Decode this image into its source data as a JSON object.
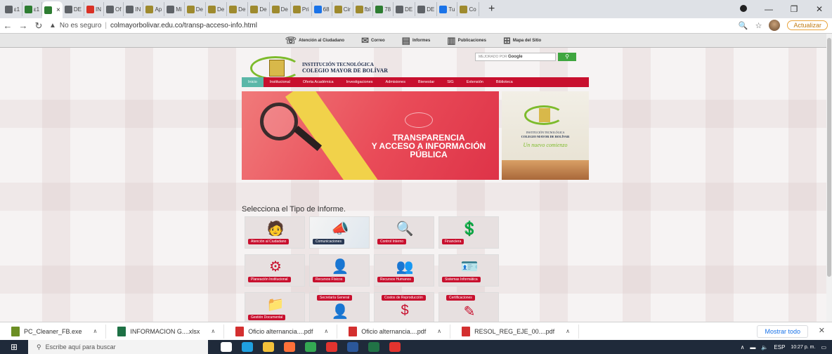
{
  "browser": {
    "tabs": [
      {
        "label": "ε1",
        "fav_color": "#5f6368"
      },
      {
        "label": "ε1",
        "fav_color": "#2e7d32"
      },
      {
        "label": "",
        "fav_color": "#2e7d32",
        "active": true
      },
      {
        "label": "DE",
        "fav_color": "#5f6368"
      },
      {
        "label": "IN",
        "fav_color": "#d93025"
      },
      {
        "label": "Of",
        "fav_color": "#5f6368"
      },
      {
        "label": "IN",
        "fav_color": "#5f6368"
      },
      {
        "label": "Ap",
        "fav_color": "#9e8a2e"
      },
      {
        "label": "Mi",
        "fav_color": "#5f6368"
      },
      {
        "label": "De",
        "fav_color": "#9e8a2e"
      },
      {
        "label": "De",
        "fav_color": "#9e8a2e"
      },
      {
        "label": "De",
        "fav_color": "#9e8a2e"
      },
      {
        "label": "De",
        "fav_color": "#9e8a2e"
      },
      {
        "label": "De",
        "fav_color": "#9e8a2e"
      },
      {
        "label": "Pri",
        "fav_color": "#9e8a2e"
      },
      {
        "label": "68",
        "fav_color": "#1a73e8"
      },
      {
        "label": "Cir",
        "fav_color": "#9e8a2e"
      },
      {
        "label": "fbl",
        "fav_color": "#9e8a2e"
      },
      {
        "label": "78",
        "fav_color": "#2e7d32"
      },
      {
        "label": "DE",
        "fav_color": "#5f6368"
      },
      {
        "label": "DE",
        "fav_color": "#5f6368"
      },
      {
        "label": "Tu",
        "fav_color": "#1a73e8"
      },
      {
        "label": "Co",
        "fav_color": "#9e8a2e"
      }
    ],
    "tab_close_glyph": "×",
    "new_tab_glyph": "+",
    "address": {
      "security_text": "No es seguro",
      "url": "colmayorbolivar.edu.co/transp-acceso-info.html"
    },
    "update_label": "Actualizar"
  },
  "site": {
    "topnav": [
      "Atención al Ciudadano",
      "Correo",
      "Informes",
      "Publicaciones",
      "Mapa del Sitio"
    ],
    "institution_line1": "INSTITUCIÓN TECNOLÓGICA",
    "institution_line2": "COLEGIO MAYOR DE BOLÍVAR",
    "search_placeholder": "MEJORADO POR",
    "search_brand": "Google",
    "menu": [
      "Inicio",
      "Institucional",
      "Oferta Académica",
      "Investigaciones",
      "Admisiones",
      "Bienestar",
      "SIG",
      "Extensión",
      "Biblioteca"
    ],
    "banner_title_lines": [
      "TRANSPARENCIA",
      "Y ACCESO A INFORMACIÓN",
      "PÚBLICA"
    ],
    "side_card_line1": "INSTITUCIÓN TECNOLÓGICA",
    "side_card_line2": "COLEGIO MAYOR DE BOLÍVAR",
    "side_card_slogan": "Un nuevo comienzo",
    "section_title": "Selecciona el Tipo de Informe.",
    "tiles": [
      {
        "label": "Atención al Ciudadano",
        "icon": "person-laptop-icon",
        "glyph": "🧑"
      },
      {
        "label": "Comunicaciones",
        "icon": "megaphone-icon",
        "glyph": "📣",
        "photo": true
      },
      {
        "label": "Control Interno",
        "icon": "document-search-icon",
        "glyph": "🔍"
      },
      {
        "label": "Financiera",
        "icon": "money-hand-icon",
        "glyph": "💲"
      },
      {
        "label": "Planeación Institucional",
        "icon": "network-people-icon",
        "glyph": "⚙"
      },
      {
        "label": "Recursos Físicos",
        "icon": "person-gear-icon",
        "glyph": "👤"
      },
      {
        "label": "Recursos Humanos",
        "icon": "people-idea-icon",
        "glyph": "👥"
      },
      {
        "label": "Sistemas Informática",
        "icon": "id-card-icon",
        "glyph": "🪪"
      },
      {
        "label": "Gestión Documental",
        "icon": "folder-icon",
        "glyph": "📁"
      },
      {
        "label": "Secretaría General",
        "icon": "person-icon",
        "glyph": "👤",
        "top": true
      },
      {
        "label": "Costos de Reproducción",
        "icon": "dollar-icon",
        "glyph": "$",
        "top": true
      },
      {
        "label": "Certificaciones",
        "icon": "certificate-icon",
        "glyph": "✎",
        "top": true
      }
    ]
  },
  "downloads": {
    "items": [
      {
        "name": "PC_Cleaner_FB.exe",
        "icon_color": "#6b8e23"
      },
      {
        "name": "INFORMACION G....xlsx",
        "icon_color": "#1e7145"
      },
      {
        "name": "Oficio alternancia....pdf",
        "icon_color": "#d32f2f"
      },
      {
        "name": "Oficio alternancia....pdf",
        "icon_color": "#d32f2f"
      },
      {
        "name": "RESOL_REG_EJE_00....pdf",
        "icon_color": "#d32f2f"
      }
    ],
    "show_all": "Mostrar todo"
  },
  "taskbar": {
    "search_placeholder": "Escribe aquí para buscar",
    "apps": [
      {
        "name": "task-view-icon",
        "color": "#ffffff"
      },
      {
        "name": "edge-icon",
        "color": "#1fa0e0"
      },
      {
        "name": "file-explorer-icon",
        "color": "#f3c13a"
      },
      {
        "name": "firefox-icon",
        "color": "#ff7139"
      },
      {
        "name": "chrome-icon",
        "color": "#34a853"
      },
      {
        "name": "acrobat-icon",
        "color": "#e3342f"
      },
      {
        "name": "word-icon",
        "color": "#2b579a"
      },
      {
        "name": "excel-icon",
        "color": "#217346"
      },
      {
        "name": "pdf-icon",
        "color": "#e3342f"
      }
    ],
    "lang": "ESP",
    "time": "10:27 p. m."
  }
}
